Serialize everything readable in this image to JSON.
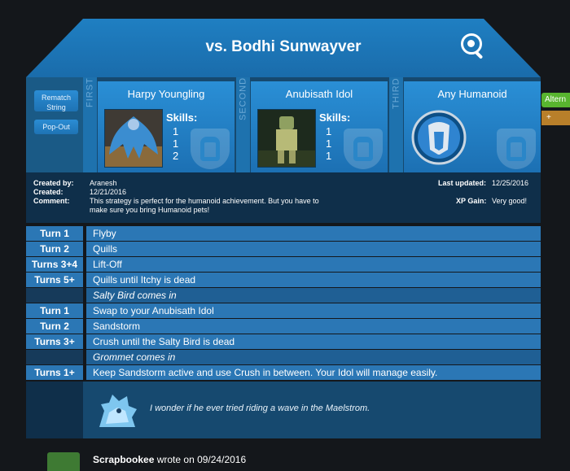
{
  "header": {
    "title": "vs. Bodhi Sunwayver",
    "search_icon": "search-magnifier-icon"
  },
  "left_buttons": {
    "rematch": "Rematch String",
    "popout": "Pop-Out"
  },
  "pets": [
    {
      "ordinal": "FIRST",
      "name": "Harpy Youngling",
      "skills_label": "Skills:",
      "skills": [
        "1",
        "1",
        "2"
      ]
    },
    {
      "ordinal": "SECOND",
      "name": "Anubisath Idol",
      "skills_label": "Skills:",
      "skills": [
        "1",
        "1",
        "1"
      ]
    },
    {
      "ordinal": "THIRD",
      "name": "Any Humanoid"
    }
  ],
  "meta": {
    "created_by_label": "Created by:",
    "created_by": "Aranesh",
    "created_label": "Created:",
    "created": "12/21/2016",
    "comment_label": "Comment:",
    "comment": "This strategy is perfect for the humanoid achievement. But you have to make sure you bring Humanoid pets!",
    "last_updated_label": "Last updated:",
    "last_updated": "12/25/2016",
    "xp_label": "XP Gain:",
    "xp": "Very good!"
  },
  "turns": [
    {
      "turn": "Turn 1",
      "action": "Flyby"
    },
    {
      "turn": "Turn 2",
      "action": "Quills"
    },
    {
      "turn": "Turns 3+4",
      "action": "Lift-Off"
    },
    {
      "turn": "Turns 5+",
      "action": "Quills until Itchy is dead"
    },
    {
      "turn": "",
      "action": "Salty Bird comes in",
      "italic": true
    },
    {
      "turn": "Turn 1",
      "action": "Swap to your Anubisath Idol"
    },
    {
      "turn": "Turn 2",
      "action": "Sandstorm"
    },
    {
      "turn": "Turns 3+",
      "action": "Crush until the Salty Bird is dead"
    },
    {
      "turn": "",
      "action": "Grommet comes in",
      "italic": true
    },
    {
      "turn": "Turns 1+",
      "action": "Keep Sandstorm active and use Crush in between. Your Idol will manage easily."
    }
  ],
  "quote": "I wonder if he ever tried riding a wave in the Maelstrom.",
  "side_tabs": {
    "alt": "Altern",
    "plus": "+"
  },
  "comment": {
    "author": "Scrapbookee",
    "wrote_on": "wrote on 09/24/2016"
  }
}
